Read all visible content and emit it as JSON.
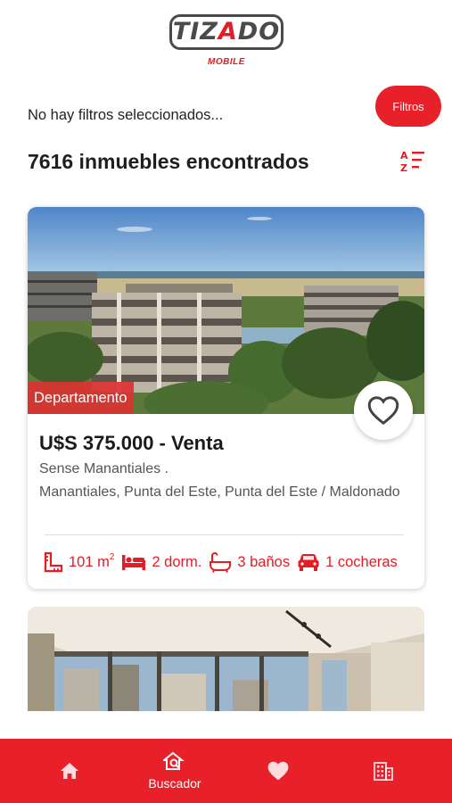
{
  "header": {
    "logo_text": "TIZADO",
    "logo_sub": "MOBILE"
  },
  "filters": {
    "status_text": "No hay filtros seleccionados...",
    "button_label": "Filtros"
  },
  "results": {
    "count_text": "7616 inmuebles encontrados",
    "sort_icon": "sort-alpha-icon"
  },
  "listings": [
    {
      "type_badge": "Departamento",
      "price": "U$S 375.000 - Venta",
      "name": "Sense Manantiales .",
      "location": "Manantiales, Punta del Este, Punta del Este / Maldonado",
      "area": "101 m",
      "area_unit_sup": "2",
      "bedrooms": "2 dorm.",
      "bathrooms": "3 baños",
      "garages": "1 cocheras"
    }
  ],
  "bottom_nav": {
    "items": [
      {
        "icon": "home-icon",
        "label": ""
      },
      {
        "icon": "search-house-icon",
        "label": "Buscador"
      },
      {
        "icon": "heart-icon",
        "label": ""
      },
      {
        "icon": "building-icon",
        "label": ""
      }
    ]
  },
  "colors": {
    "brand_red": "#e8202a",
    "text_dark": "#1a1a1a",
    "text_muted": "#555555"
  }
}
